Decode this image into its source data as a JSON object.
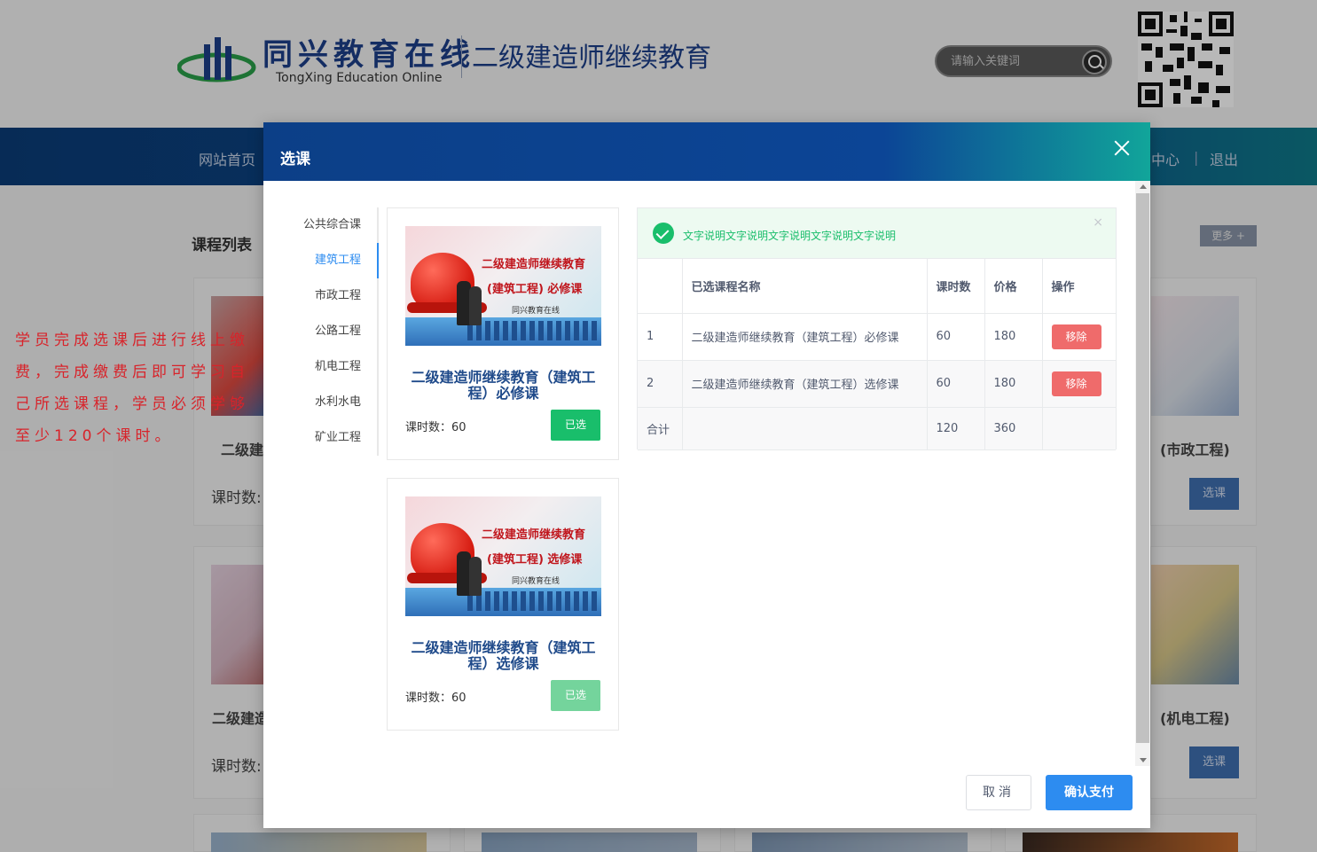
{
  "site": {
    "logo_cn": "同兴教育在线",
    "logo_en": "TongXing Education Online",
    "subtitle": "二级建造师继续教育",
    "search_placeholder": "请输入关键词"
  },
  "nav": {
    "home": "网站首页",
    "center": "中心",
    "divider": "|",
    "logout": "退出"
  },
  "background": {
    "course_list_title": "课程列表",
    "more": "更多 +",
    "cards": [
      {
        "title": "二级建",
        "hours": "课时数:"
      },
      {
        "title": "(市政工程)",
        "button": "选课"
      },
      {
        "title": "二级建造",
        "hours": "课时数:"
      },
      {
        "title": "(机电工程)",
        "button": "选课"
      }
    ]
  },
  "annotation": "学员完成选课后进行线上缴费，完成缴费后即可学习自己所选课程，学员必须学够至少120个课时。",
  "modal": {
    "title": "选课",
    "categories": [
      "公共综合课",
      "建筑工程",
      "市政工程",
      "公路工程",
      "机电工程",
      "水利水电",
      "矿业工程"
    ],
    "active_category": "建筑工程",
    "courses": [
      {
        "img_line1": "二级建造师继续教育",
        "img_line2": "(建筑工程) 必修课",
        "img_line3": "同兴教育在线",
        "name": "二级建造师继续教育（建筑工程）必修课",
        "hours": "课时数：60",
        "button": "已选"
      },
      {
        "img_line1": "二级建造师继续教育",
        "img_line2": "(建筑工程) 选修课",
        "img_line3": "同兴教育在线",
        "name": "二级建造师继续教育（建筑工程）选修课",
        "hours": "课时数：60",
        "button": "已选"
      }
    ],
    "alert": {
      "text": "文字说明文字说明文字说明文字说明文字说明",
      "close": "×"
    },
    "table": {
      "headers": [
        "",
        "已选课程名称",
        "课时数",
        "价格",
        "操作"
      ],
      "rows": [
        {
          "index": "1",
          "name": "二级建造师继续教育（建筑工程）必修课",
          "hours": "60",
          "price": "180",
          "action": "移除"
        },
        {
          "index": "2",
          "name": "二级建造师继续教育（建筑工程）选修课",
          "hours": "60",
          "price": "180",
          "action": "移除"
        }
      ],
      "total": {
        "label": "合计",
        "hours": "120",
        "price": "360"
      }
    },
    "cancel": "取消",
    "confirm": "确认支付"
  }
}
